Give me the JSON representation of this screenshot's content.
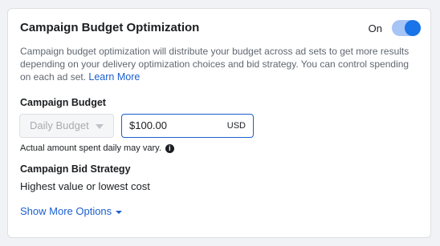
{
  "card": {
    "title": "Campaign Budget Optimization",
    "toggle_label": "On",
    "toggle_state": "on",
    "description": "Campaign budget optimization will distribute your budget across ad sets to get more results depending on your delivery optimization choices and bid strategy. You can control spending on each ad set.",
    "learn_more": "Learn More"
  },
  "budget": {
    "label": "Campaign Budget",
    "type_selected": "Daily Budget",
    "amount": "$100.00",
    "currency": "USD",
    "hint": "Actual amount spent daily may vary."
  },
  "bid": {
    "label": "Campaign Bid Strategy",
    "value": "Highest value or lowest cost"
  },
  "show_more": "Show More Options",
  "colors": {
    "accent": "#1a5fd0",
    "toggle_track": "#a6c4f5",
    "toggle_knob": "#1a73e8"
  }
}
